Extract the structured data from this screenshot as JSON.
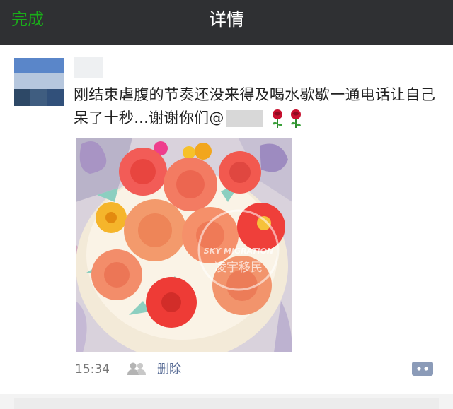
{
  "navbar": {
    "done_label": "完成",
    "title": "详情"
  },
  "post": {
    "text_main": "刚结束虐腹的节奏还没来得及喝水歇歇一通电话让自己呆了十秒...谢谢你们@",
    "emoji_icons": [
      "rose-icon",
      "rose-icon"
    ],
    "photo_watermark_en": "SKY MIGRATION",
    "photo_watermark_cn": "凌宇移民",
    "timestamp": "15:34",
    "delete_label": "删除"
  },
  "colors": {
    "navbar_bg": "#2f3033",
    "done_green": "#1aad19",
    "link_blue": "#576b95"
  }
}
